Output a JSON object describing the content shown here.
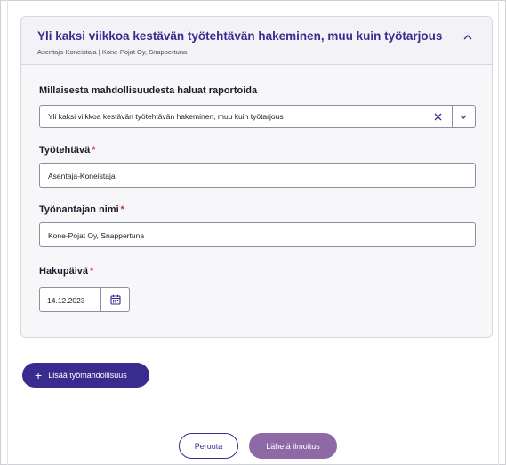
{
  "card": {
    "title": "Yli kaksi viikkoa kestävän työtehtävän hakeminen, muu kuin työtarjous",
    "subtitle": "Asentaja-Koneistaja | Kone-Pojat Oy, Snappertuna"
  },
  "form": {
    "opportunity": {
      "label": "Millaisesta mahdollisuudesta haluat raportoida",
      "value": "Yli kaksi viikkoa kestävän työtehtävän hakeminen, muu kuin työtarjous"
    },
    "job_title": {
      "label": "Työtehtävä",
      "required_mark": "*",
      "value": "Asentaja-Koneistaja"
    },
    "employer": {
      "label": "Työnantajan nimi",
      "required_mark": "*",
      "value": "Kone-Pojat Oy, Snappertuna"
    },
    "date": {
      "label": "Hakupäivä",
      "required_mark": "*",
      "value": "14.12.2023"
    }
  },
  "actions": {
    "add_plus": "+",
    "add_label": "Lisää työmahdollisuus",
    "cancel_label": "Peruuta",
    "submit_label": "Lähetä ilmoitus"
  },
  "colors": {
    "primary": "#3a2b8e",
    "submit": "#8d6aa6",
    "required": "#c8324a"
  }
}
